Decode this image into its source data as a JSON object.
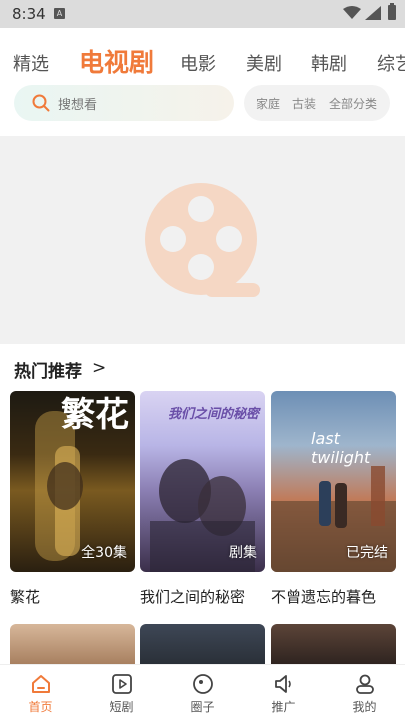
{
  "status_bar": {
    "time": "8:34",
    "notif_badge": "A"
  },
  "tabs": [
    {
      "label": "精选"
    },
    {
      "label": "电视剧"
    },
    {
      "label": "电影"
    },
    {
      "label": "美剧"
    },
    {
      "label": "韩剧"
    },
    {
      "label": "综艺"
    }
  ],
  "search": {
    "placeholder": "搜想看"
  },
  "filters": [
    "家庭",
    "古装",
    "全部分类"
  ],
  "section": {
    "title": "热门推荐",
    "arrow": ">"
  },
  "cards": [
    {
      "title": "繁花",
      "badge": "全30集",
      "poster_text": "繁花"
    },
    {
      "title": "我们之间的秘密",
      "badge": "剧集",
      "poster_text": "我们之间的秘密"
    },
    {
      "title": "不曾遗忘的暮色",
      "badge": "已完结",
      "poster_text": "last twilight"
    }
  ],
  "bottom_nav": [
    {
      "label": "首页",
      "icon": "home-icon",
      "active": true
    },
    {
      "label": "短剧",
      "icon": "play-square-icon"
    },
    {
      "label": "圈子",
      "icon": "circle-icon"
    },
    {
      "label": "推广",
      "icon": "speaker-icon"
    },
    {
      "label": "我的",
      "icon": "person-icon"
    }
  ],
  "colors": {
    "accent": "#f07a3a"
  }
}
